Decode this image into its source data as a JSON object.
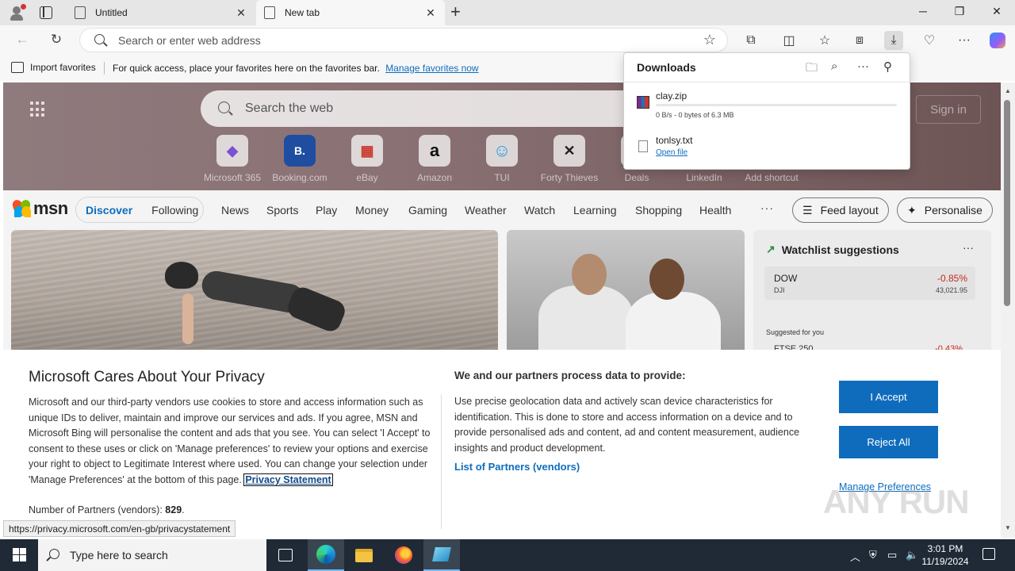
{
  "browser": {
    "tabs": [
      {
        "title": "Untitled",
        "active": false
      },
      {
        "title": "New tab",
        "active": true
      }
    ],
    "address_placeholder": "Search or enter web address",
    "favorites_bar": {
      "import_label": "Import favorites",
      "message": "For quick access, place your favorites here on the favorites bar.",
      "manage_link": "Manage favorites now"
    },
    "status_url": "https://privacy.microsoft.com/en-gb/privacystatement"
  },
  "downloads": {
    "title": "Downloads",
    "items": [
      {
        "name": "clay.zip",
        "status": "0 B/s - 0 bytes of 6.3 MB",
        "progress": 0
      },
      {
        "name": "tonlsy.txt",
        "action": "Open file"
      }
    ]
  },
  "newtab": {
    "search_placeholder": "Search the web",
    "signin": "Sign in",
    "tiles": [
      {
        "label": "Microsoft 365",
        "glyph": "◆"
      },
      {
        "label": "Booking.com",
        "glyph": "B."
      },
      {
        "label": "eBay",
        "glyph": "▦"
      },
      {
        "label": "Amazon",
        "glyph": "a"
      },
      {
        "label": "TUI",
        "glyph": "☺"
      },
      {
        "label": "Forty Thieves",
        "glyph": "✕"
      },
      {
        "label": "Deals",
        "glyph": ""
      },
      {
        "label": "LinkedIn",
        "glyph": ""
      },
      {
        "label": "Add shortcut",
        "glyph": ""
      }
    ],
    "msn": {
      "logo": "msn",
      "pills": [
        "Discover",
        "Following"
      ],
      "nav": [
        "News",
        "Sports",
        "Play",
        "Money",
        "Gaming",
        "Weather",
        "Watch",
        "Learning",
        "Shopping",
        "Health"
      ],
      "more": "···",
      "feed_layout": "Feed layout",
      "personalise": "Personalise"
    },
    "watchlist": {
      "title": "Watchlist suggestions",
      "more": "···",
      "stock": {
        "symbol": "DOW",
        "sub": "DJI",
        "change": "-0.85%",
        "price": "43,021.95"
      },
      "suggested_label": "Suggested for you",
      "ftse": "FTSE 250",
      "ftse_change": "-0.43%"
    }
  },
  "privacy": {
    "title": "Microsoft Cares About Your Privacy",
    "body": "Microsoft and our third-party vendors use cookies to store and access information such as unique IDs to deliver, maintain and improve our services and ads. If you agree, MSN and Microsoft Bing will personalise the content and ads that you see. You can select 'I Accept' to consent to these uses or click on 'Manage preferences' to review your options and exercise your right to object to Legitimate Interest where used.  You can change your selection under 'Manage Preferences' at the bottom of this page.",
    "privacy_link": "Privacy Statement",
    "partners_label": "Number of Partners (vendors):",
    "partners_count": "829",
    "partners_period": ".",
    "data_heading": "We and our partners process data to provide:",
    "data_body": "Use precise geolocation data and actively scan device characteristics for identification. This is done to store and access information on a device and to provide personalised ads and content, ad and content measurement, audience insights and product development.",
    "vendors_link": "List of Partners (vendors)",
    "accept": "I Accept",
    "reject": "Reject All",
    "manage": "Manage Preferences"
  },
  "watermark": "ANY RUN",
  "taskbar": {
    "search_placeholder": "Type here to search",
    "time": "3:01 PM",
    "date": "11/19/2024"
  }
}
